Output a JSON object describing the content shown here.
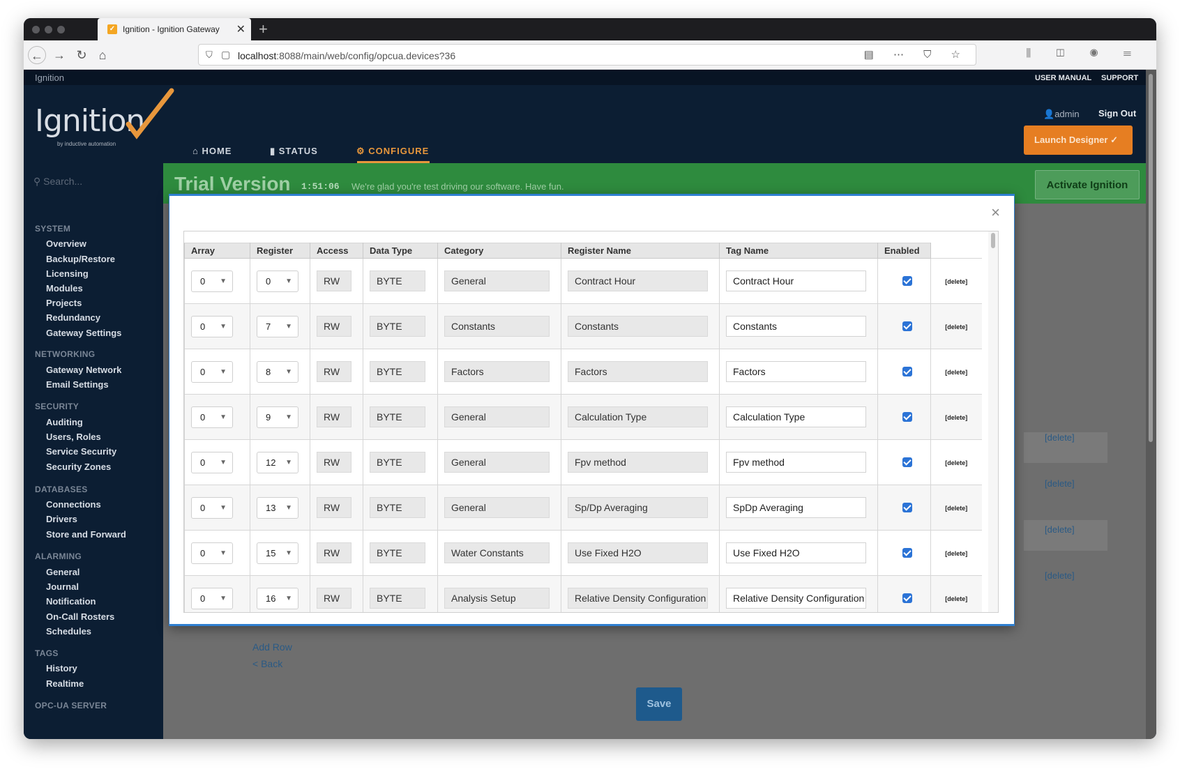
{
  "browser": {
    "tab_title": "Ignition - Ignition Gateway",
    "url_host": "localhost",
    "url_rest": ":8088/main/web/config/opcua.devices?36"
  },
  "gateway": {
    "brand_small": "Ignition",
    "user_manual": "USER MANUAL",
    "support": "SUPPORT",
    "user": "admin",
    "sign_out": "Sign Out",
    "logo_text": "Ignition",
    "logo_tagline": "by inductive automation",
    "launch_designer": "Launch Designer",
    "nav": {
      "home": "HOME",
      "status": "STATUS",
      "configure": "CONFIGURE"
    }
  },
  "sidebar": {
    "search_placeholder": "Search...",
    "sections": [
      {
        "title": "SYSTEM",
        "items": [
          "Overview",
          "Backup/Restore",
          "Licensing",
          "Modules",
          "Projects",
          "Redundancy",
          "Gateway Settings"
        ]
      },
      {
        "title": "NETWORKING",
        "items": [
          "Gateway Network",
          "Email Settings"
        ]
      },
      {
        "title": "SECURITY",
        "items": [
          "Auditing",
          "Users, Roles",
          "Service Security",
          "Security Zones"
        ]
      },
      {
        "title": "DATABASES",
        "items": [
          "Connections",
          "Drivers",
          "Store and Forward"
        ]
      },
      {
        "title": "ALARMING",
        "items": [
          "General",
          "Journal",
          "Notification",
          "On-Call Rosters",
          "Schedules"
        ]
      },
      {
        "title": "TAGS",
        "items": [
          "History",
          "Realtime"
        ]
      },
      {
        "title": "OPC-UA SERVER",
        "items": []
      }
    ]
  },
  "trial": {
    "title": "Trial Version",
    "timer": "1:51:06",
    "message": "We're glad you're test driving our software. Have fun.",
    "activate": "Activate Ignition"
  },
  "background": {
    "delete_label": "[delete]",
    "add_row": "Add Row",
    "back": "< Back",
    "save": "Save"
  },
  "modal": {
    "close": "×",
    "columns": [
      "Array",
      "Register",
      "Access",
      "Data Type",
      "Category",
      "Register Name",
      "Tag Name",
      "Enabled"
    ],
    "delete_label": "[delete]",
    "rows": [
      {
        "array": "0",
        "register": "0",
        "access": "RW",
        "data_type": "BYTE",
        "category": "General",
        "register_name": "Contract Hour",
        "tag_name": "Contract Hour",
        "enabled": true
      },
      {
        "array": "0",
        "register": "7",
        "access": "RW",
        "data_type": "BYTE",
        "category": "Constants",
        "register_name": "Constants",
        "tag_name": "Constants",
        "enabled": true
      },
      {
        "array": "0",
        "register": "8",
        "access": "RW",
        "data_type": "BYTE",
        "category": "Factors",
        "register_name": "Factors",
        "tag_name": "Factors",
        "enabled": true
      },
      {
        "array": "0",
        "register": "9",
        "access": "RW",
        "data_type": "BYTE",
        "category": "General",
        "register_name": "Calculation Type",
        "tag_name": "Calculation Type",
        "enabled": true
      },
      {
        "array": "0",
        "register": "12",
        "access": "RW",
        "data_type": "BYTE",
        "category": "General",
        "register_name": "Fpv method",
        "tag_name": "Fpv method",
        "enabled": true
      },
      {
        "array": "0",
        "register": "13",
        "access": "RW",
        "data_type": "BYTE",
        "category": "General",
        "register_name": "Sp/Dp Averaging",
        "tag_name": "SpDp Averaging",
        "enabled": true
      },
      {
        "array": "0",
        "register": "15",
        "access": "RW",
        "data_type": "BYTE",
        "category": "Water Constants",
        "register_name": "Use Fixed H2O",
        "tag_name": "Use Fixed H2O",
        "enabled": true
      },
      {
        "array": "0",
        "register": "16",
        "access": "RW",
        "data_type": "BYTE",
        "category": "Analysis Setup",
        "register_name": "Relative Density Configuration",
        "tag_name": "Relative Density Configuration",
        "enabled": true
      }
    ]
  }
}
